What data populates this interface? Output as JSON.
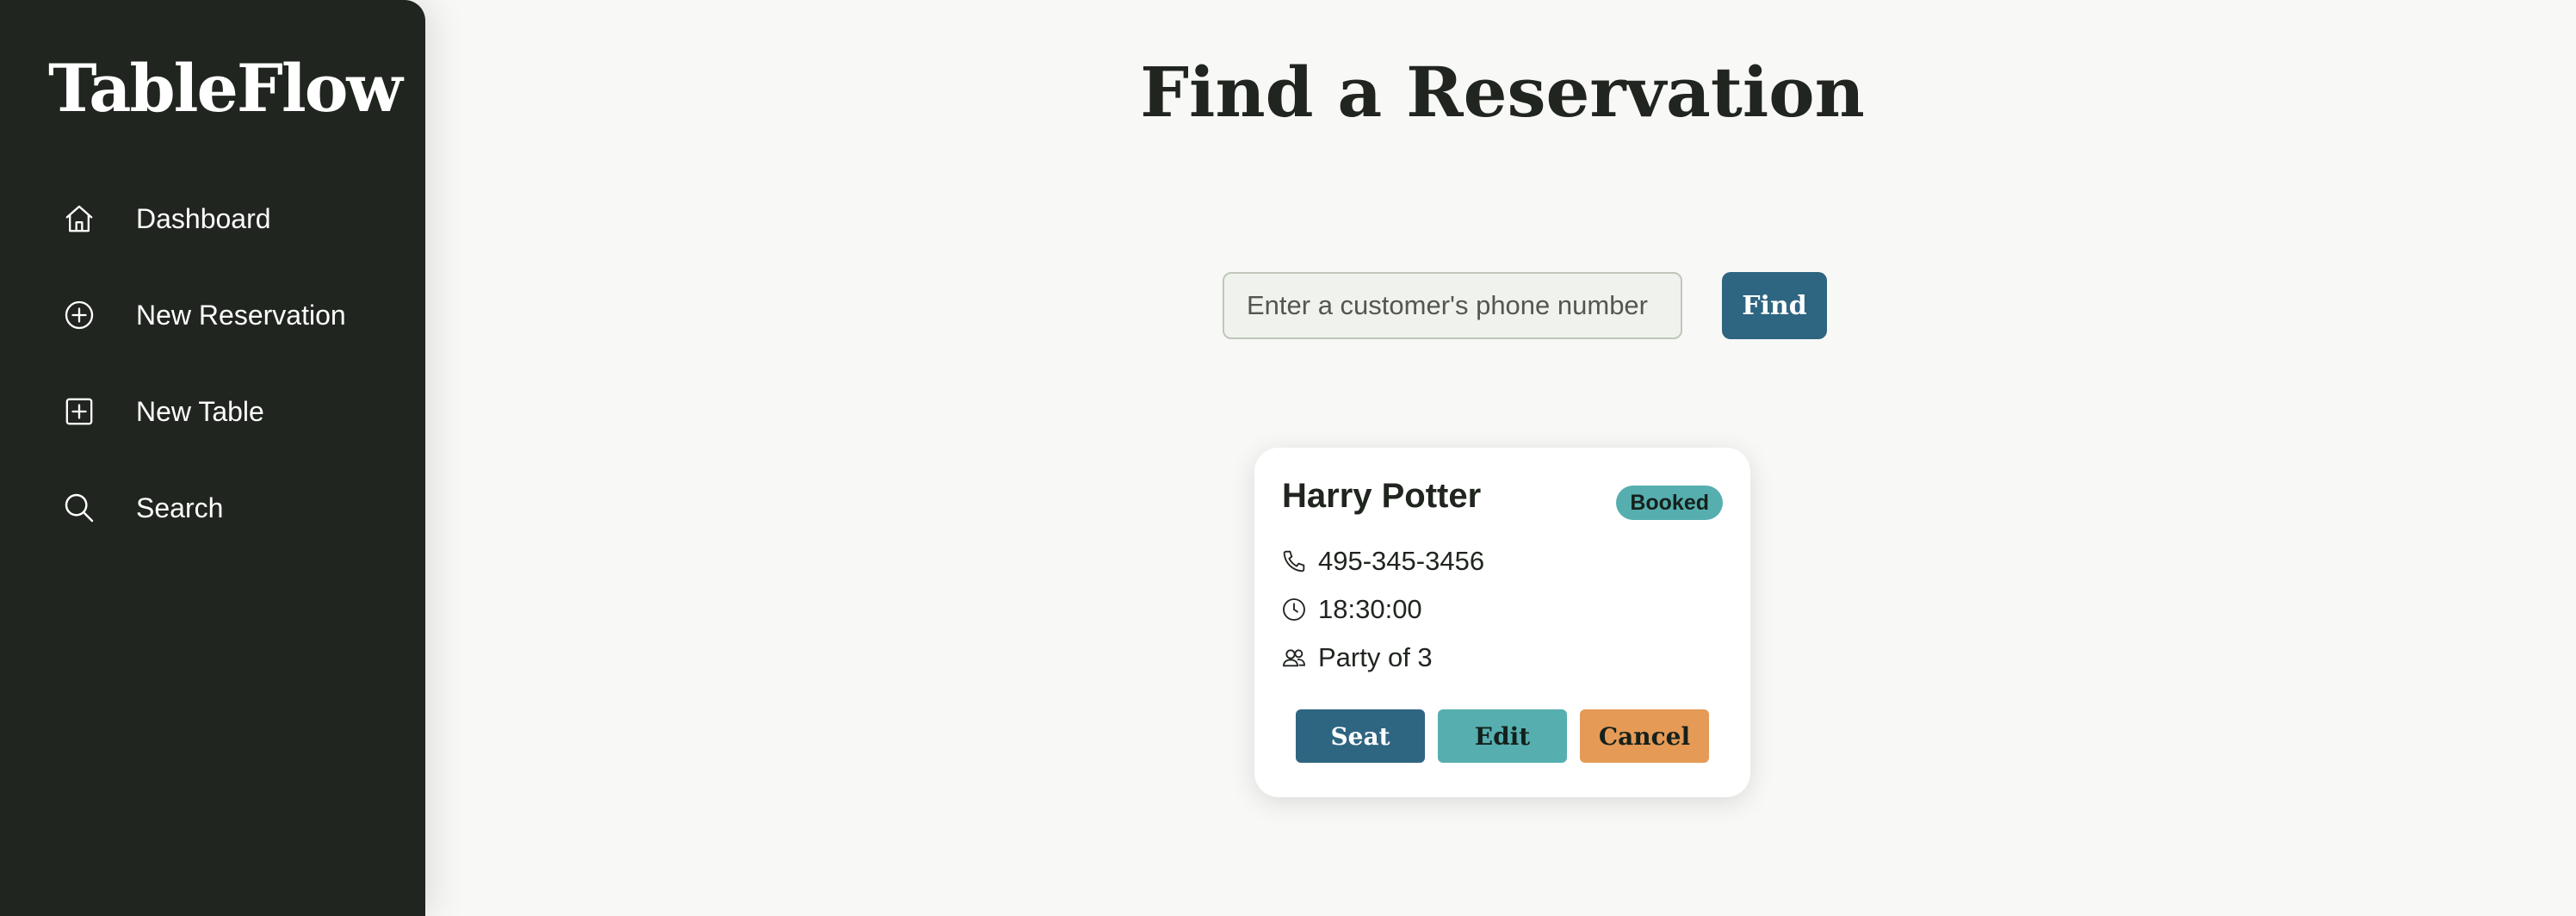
{
  "app": {
    "brand": "TableFlow"
  },
  "sidebar": {
    "items": [
      {
        "label": "Dashboard",
        "icon": "home-icon"
      },
      {
        "label": "New Reservation",
        "icon": "plus-circle-icon"
      },
      {
        "label": "New Table",
        "icon": "plus-square-icon"
      },
      {
        "label": "Search",
        "icon": "search-icon"
      }
    ]
  },
  "main": {
    "title": "Find a Reservation",
    "search": {
      "placeholder": "Enter a customer's phone number",
      "value": ""
    },
    "find_label": "Find"
  },
  "reservation": {
    "name": "Harry Potter",
    "status": "Booked",
    "phone": "495-345-3456",
    "time": "18:30:00",
    "party": "Party of 3",
    "actions": {
      "seat": "Seat",
      "edit": "Edit",
      "cancel": "Cancel"
    }
  },
  "colors": {
    "sidebar_bg": "#20251f",
    "page_bg": "#f8f8f6",
    "primary": "#2e6581",
    "teal": "#56aeaf",
    "orange": "#e59a56"
  }
}
